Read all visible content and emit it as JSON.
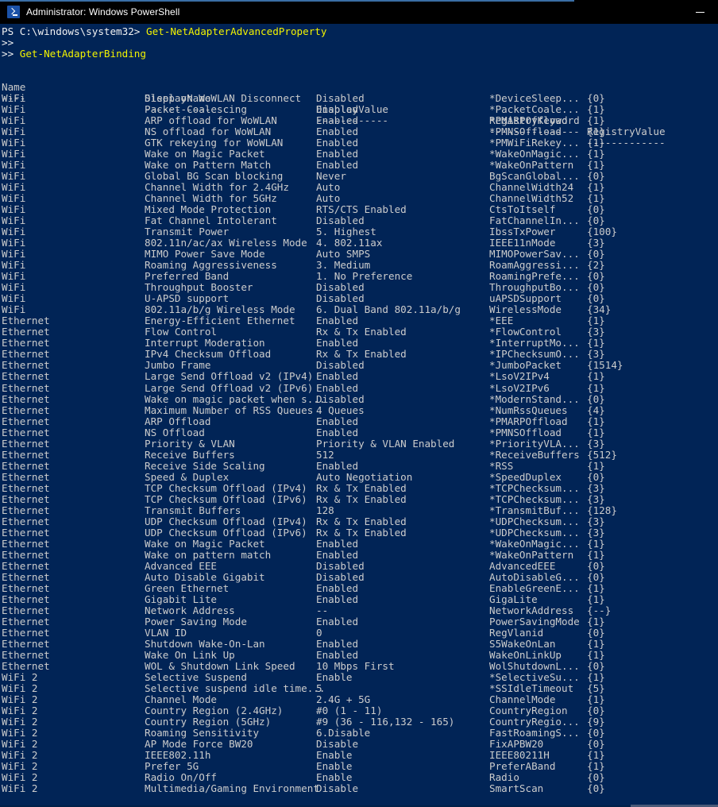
{
  "window": {
    "title": "Administrator: Windows PowerShell",
    "icon": "powershell-icon",
    "minimize_label": "Minimize",
    "background_color": "#012456",
    "titlebar_color": "#000000",
    "text_color": "#cccccc",
    "command_color": "#f3f300"
  },
  "console": {
    "prompt_lines": [
      {
        "prompt": "PS C:\\windows\\system32> ",
        "command": "Get-NetAdapterAdvancedProperty"
      },
      {
        "prompt": ">>",
        "command": ""
      },
      {
        "prompt": ">> ",
        "command": "Get-NetAdapterBinding"
      }
    ],
    "headers": {
      "name": "Name",
      "display_name": "DisplayName",
      "display_value": "DisplayValue",
      "registry_keyword": "RegistryKeyword",
      "registry_value": "RegistryValue"
    },
    "separators": {
      "name": "----",
      "display_name": "-----------",
      "display_value": "------------",
      "registry_keyword": "---------------",
      "registry_value": "-------------"
    },
    "rows": [
      {
        "name": "WiFi",
        "display_name": "Sleep on WoWLAN Disconnect",
        "display_value": "Disabled",
        "registry_keyword": "*DeviceSleep...",
        "registry_value": "{0}"
      },
      {
        "name": "WiFi",
        "display_name": "Packet Coalescing",
        "display_value": "Enabled",
        "registry_keyword": "*PacketCoale...",
        "registry_value": "{1}"
      },
      {
        "name": "WiFi",
        "display_name": "ARP offload for WoWLAN",
        "display_value": "Enabled",
        "registry_keyword": "*PMARPOffload",
        "registry_value": "{1}"
      },
      {
        "name": "WiFi",
        "display_name": "NS offload for WoWLAN",
        "display_value": "Enabled",
        "registry_keyword": "*PMNSOffload",
        "registry_value": "{1}"
      },
      {
        "name": "WiFi",
        "display_name": "GTK rekeying for WoWLAN",
        "display_value": "Enabled",
        "registry_keyword": "*PMWiFiRekey...",
        "registry_value": "{1}"
      },
      {
        "name": "WiFi",
        "display_name": "Wake on Magic Packet",
        "display_value": "Enabled",
        "registry_keyword": "*WakeOnMagic...",
        "registry_value": "{1}"
      },
      {
        "name": "WiFi",
        "display_name": "Wake on Pattern Match",
        "display_value": "Enabled",
        "registry_keyword": "*WakeOnPattern",
        "registry_value": "{1}"
      },
      {
        "name": "WiFi",
        "display_name": "Global BG Scan blocking",
        "display_value": "Never",
        "registry_keyword": "BgScanGlobal...",
        "registry_value": "{0}"
      },
      {
        "name": "WiFi",
        "display_name": "Channel Width for 2.4GHz",
        "display_value": "Auto",
        "registry_keyword": "ChannelWidth24",
        "registry_value": "{1}"
      },
      {
        "name": "WiFi",
        "display_name": "Channel Width for 5GHz",
        "display_value": "Auto",
        "registry_keyword": "ChannelWidth52",
        "registry_value": "{1}"
      },
      {
        "name": "WiFi",
        "display_name": "Mixed Mode Protection",
        "display_value": "RTS/CTS Enabled",
        "registry_keyword": "CtsToItself",
        "registry_value": "{0}"
      },
      {
        "name": "WiFi",
        "display_name": "Fat Channel Intolerant",
        "display_value": "Disabled",
        "registry_keyword": "FatChannelIn...",
        "registry_value": "{0}"
      },
      {
        "name": "WiFi",
        "display_name": "Transmit Power",
        "display_value": "5. Highest",
        "registry_keyword": "IbssTxPower",
        "registry_value": "{100}"
      },
      {
        "name": "WiFi",
        "display_name": "802.11n/ac/ax Wireless Mode",
        "display_value": "4. 802.11ax",
        "registry_keyword": "IEEE11nMode",
        "registry_value": "{3}"
      },
      {
        "name": "WiFi",
        "display_name": "MIMO Power Save Mode",
        "display_value": "Auto SMPS",
        "registry_keyword": "MIMOPowerSav...",
        "registry_value": "{0}"
      },
      {
        "name": "WiFi",
        "display_name": "Roaming Aggressiveness",
        "display_value": "3. Medium",
        "registry_keyword": "RoamAggressi...",
        "registry_value": "{2}"
      },
      {
        "name": "WiFi",
        "display_name": "Preferred Band",
        "display_value": "1. No Preference",
        "registry_keyword": "RoamingPrefe...",
        "registry_value": "{0}"
      },
      {
        "name": "WiFi",
        "display_name": "Throughput Booster",
        "display_value": "Disabled",
        "registry_keyword": "ThroughputBo...",
        "registry_value": "{0}"
      },
      {
        "name": "WiFi",
        "display_name": "U-APSD support",
        "display_value": "Disabled",
        "registry_keyword": "uAPSDSupport",
        "registry_value": "{0}"
      },
      {
        "name": "WiFi",
        "display_name": "802.11a/b/g Wireless Mode",
        "display_value": "6. Dual Band 802.11a/b/g",
        "registry_keyword": "WirelessMode",
        "registry_value": "{34}"
      },
      {
        "name": "Ethernet",
        "display_name": "Energy-Efficient Ethernet",
        "display_value": "Enabled",
        "registry_keyword": "*EEE",
        "registry_value": "{1}"
      },
      {
        "name": "Ethernet",
        "display_name": "Flow Control",
        "display_value": "Rx & Tx Enabled",
        "registry_keyword": "*FlowControl",
        "registry_value": "{3}"
      },
      {
        "name": "Ethernet",
        "display_name": "Interrupt Moderation",
        "display_value": "Enabled",
        "registry_keyword": "*InterruptMo...",
        "registry_value": "{1}"
      },
      {
        "name": "Ethernet",
        "display_name": "IPv4 Checksum Offload",
        "display_value": "Rx & Tx Enabled",
        "registry_keyword": "*IPChecksumO...",
        "registry_value": "{3}"
      },
      {
        "name": "Ethernet",
        "display_name": "Jumbo Frame",
        "display_value": "Disabled",
        "registry_keyword": "*JumboPacket",
        "registry_value": "{1514}"
      },
      {
        "name": "Ethernet",
        "display_name": "Large Send Offload v2 (IPv4)",
        "display_value": "Enabled",
        "registry_keyword": "*LsoV2IPv4",
        "registry_value": "{1}"
      },
      {
        "name": "Ethernet",
        "display_name": "Large Send Offload v2 (IPv6)",
        "display_value": "Enabled",
        "registry_keyword": "*LsoV2IPv6",
        "registry_value": "{1}"
      },
      {
        "name": "Ethernet",
        "display_name": "Wake on magic packet when s...",
        "display_value": "Disabled",
        "registry_keyword": "*ModernStand...",
        "registry_value": "{0}"
      },
      {
        "name": "Ethernet",
        "display_name": "Maximum Number of RSS Queues",
        "display_value": "4 Queues",
        "registry_keyword": "*NumRssQueues",
        "registry_value": "{4}"
      },
      {
        "name": "Ethernet",
        "display_name": "ARP Offload",
        "display_value": "Enabled",
        "registry_keyword": "*PMARPOffload",
        "registry_value": "{1}"
      },
      {
        "name": "Ethernet",
        "display_name": "NS Offload",
        "display_value": "Enabled",
        "registry_keyword": "*PMNSOffload",
        "registry_value": "{1}"
      },
      {
        "name": "Ethernet",
        "display_name": "Priority & VLAN",
        "display_value": "Priority & VLAN Enabled",
        "registry_keyword": "*PriorityVLA...",
        "registry_value": "{3}"
      },
      {
        "name": "Ethernet",
        "display_name": "Receive Buffers",
        "display_value": "512",
        "registry_keyword": "*ReceiveBuffers",
        "registry_value": "{512}"
      },
      {
        "name": "Ethernet",
        "display_name": "Receive Side Scaling",
        "display_value": "Enabled",
        "registry_keyword": "*RSS",
        "registry_value": "{1}"
      },
      {
        "name": "Ethernet",
        "display_name": "Speed & Duplex",
        "display_value": "Auto Negotiation",
        "registry_keyword": "*SpeedDuplex",
        "registry_value": "{0}"
      },
      {
        "name": "Ethernet",
        "display_name": "TCP Checksum Offload (IPv4)",
        "display_value": "Rx & Tx Enabled",
        "registry_keyword": "*TCPChecksum...",
        "registry_value": "{3}"
      },
      {
        "name": "Ethernet",
        "display_name": "TCP Checksum Offload (IPv6)",
        "display_value": "Rx & Tx Enabled",
        "registry_keyword": "*TCPChecksum...",
        "registry_value": "{3}"
      },
      {
        "name": "Ethernet",
        "display_name": "Transmit Buffers",
        "display_value": "128",
        "registry_keyword": "*TransmitBuf...",
        "registry_value": "{128}"
      },
      {
        "name": "Ethernet",
        "display_name": "UDP Checksum Offload (IPv4)",
        "display_value": "Rx & Tx Enabled",
        "registry_keyword": "*UDPChecksum...",
        "registry_value": "{3}"
      },
      {
        "name": "Ethernet",
        "display_name": "UDP Checksum Offload (IPv6)",
        "display_value": "Rx & Tx Enabled",
        "registry_keyword": "*UDPChecksum...",
        "registry_value": "{3}"
      },
      {
        "name": "Ethernet",
        "display_name": "Wake on Magic Packet",
        "display_value": "Enabled",
        "registry_keyword": "*WakeOnMagic...",
        "registry_value": "{1}"
      },
      {
        "name": "Ethernet",
        "display_name": "Wake on pattern match",
        "display_value": "Enabled",
        "registry_keyword": "*WakeOnPattern",
        "registry_value": "{1}"
      },
      {
        "name": "Ethernet",
        "display_name": "Advanced EEE",
        "display_value": "Disabled",
        "registry_keyword": "AdvancedEEE",
        "registry_value": "{0}"
      },
      {
        "name": "Ethernet",
        "display_name": "Auto Disable Gigabit",
        "display_value": "Disabled",
        "registry_keyword": "AutoDisableG...",
        "registry_value": "{0}"
      },
      {
        "name": "Ethernet",
        "display_name": "Green Ethernet",
        "display_value": "Enabled",
        "registry_keyword": "EnableGreenE...",
        "registry_value": "{1}"
      },
      {
        "name": "Ethernet",
        "display_name": "Gigabit Lite",
        "display_value": "Enabled",
        "registry_keyword": "GigaLite",
        "registry_value": "{1}"
      },
      {
        "name": "Ethernet",
        "display_name": "Network Address",
        "display_value": "--",
        "registry_keyword": "NetworkAddress",
        "registry_value": "{--}"
      },
      {
        "name": "Ethernet",
        "display_name": "Power Saving Mode",
        "display_value": "Enabled",
        "registry_keyword": "PowerSavingMode",
        "registry_value": "{1}"
      },
      {
        "name": "Ethernet",
        "display_name": "VLAN ID",
        "display_value": "0",
        "registry_keyword": "RegVlanid",
        "registry_value": "{0}"
      },
      {
        "name": "Ethernet",
        "display_name": "Shutdown Wake-On-Lan",
        "display_value": "Enabled",
        "registry_keyword": "S5WakeOnLan",
        "registry_value": "{1}"
      },
      {
        "name": "Ethernet",
        "display_name": "Wake On Link Up",
        "display_value": "Enabled",
        "registry_keyword": "WakeOnLinkUp",
        "registry_value": "{1}"
      },
      {
        "name": "Ethernet",
        "display_name": "WOL & Shutdown Link Speed",
        "display_value": "10 Mbps First",
        "registry_keyword": "WolShutdownL...",
        "registry_value": "{0}"
      },
      {
        "name": "WiFi 2",
        "display_name": "Selective Suspend",
        "display_value": "Enable",
        "registry_keyword": "*SelectiveSu...",
        "registry_value": "{1}"
      },
      {
        "name": "WiFi 2",
        "display_name": "Selective suspend idle time...",
        "display_value": "5",
        "registry_keyword": "*SSIdleTimeout",
        "registry_value": "{5}"
      },
      {
        "name": "WiFi 2",
        "display_name": "Channel Mode",
        "display_value": "2.4G + 5G",
        "registry_keyword": "ChannelMode",
        "registry_value": "{1}"
      },
      {
        "name": "WiFi 2",
        "display_name": "Country Region (2.4GHz)",
        "display_value": "#0 (1 - 11)",
        "registry_keyword": "CountryRegion",
        "registry_value": "{0}"
      },
      {
        "name": "WiFi 2",
        "display_name": "Country Region (5GHz)",
        "display_value": "#9 (36 - 116,132 - 165)",
        "registry_keyword": "CountryRegio...",
        "registry_value": "{9}"
      },
      {
        "name": "WiFi 2",
        "display_name": "Roaming Sensitivity",
        "display_value": "6.Disable",
        "registry_keyword": "FastRoamingS...",
        "registry_value": "{0}"
      },
      {
        "name": "WiFi 2",
        "display_name": "AP Mode Force BW20",
        "display_value": "Disable",
        "registry_keyword": "FixAPBW20",
        "registry_value": "{0}"
      },
      {
        "name": "WiFi 2",
        "display_name": "IEEE802.11h",
        "display_value": "Enable",
        "registry_keyword": "IEEE80211H",
        "registry_value": "{1}"
      },
      {
        "name": "WiFi 2",
        "display_name": "Prefer 5G",
        "display_value": "Enable",
        "registry_keyword": "PreferABand",
        "registry_value": "{1}"
      },
      {
        "name": "WiFi 2",
        "display_name": "Radio On/Off",
        "display_value": "Enable",
        "registry_keyword": "Radio",
        "registry_value": "{0}"
      },
      {
        "name": "WiFi 2",
        "display_name": "Multimedia/Gaming Environment",
        "display_value": "Disable",
        "registry_keyword": "SmartScan",
        "registry_value": "{0}"
      }
    ]
  }
}
